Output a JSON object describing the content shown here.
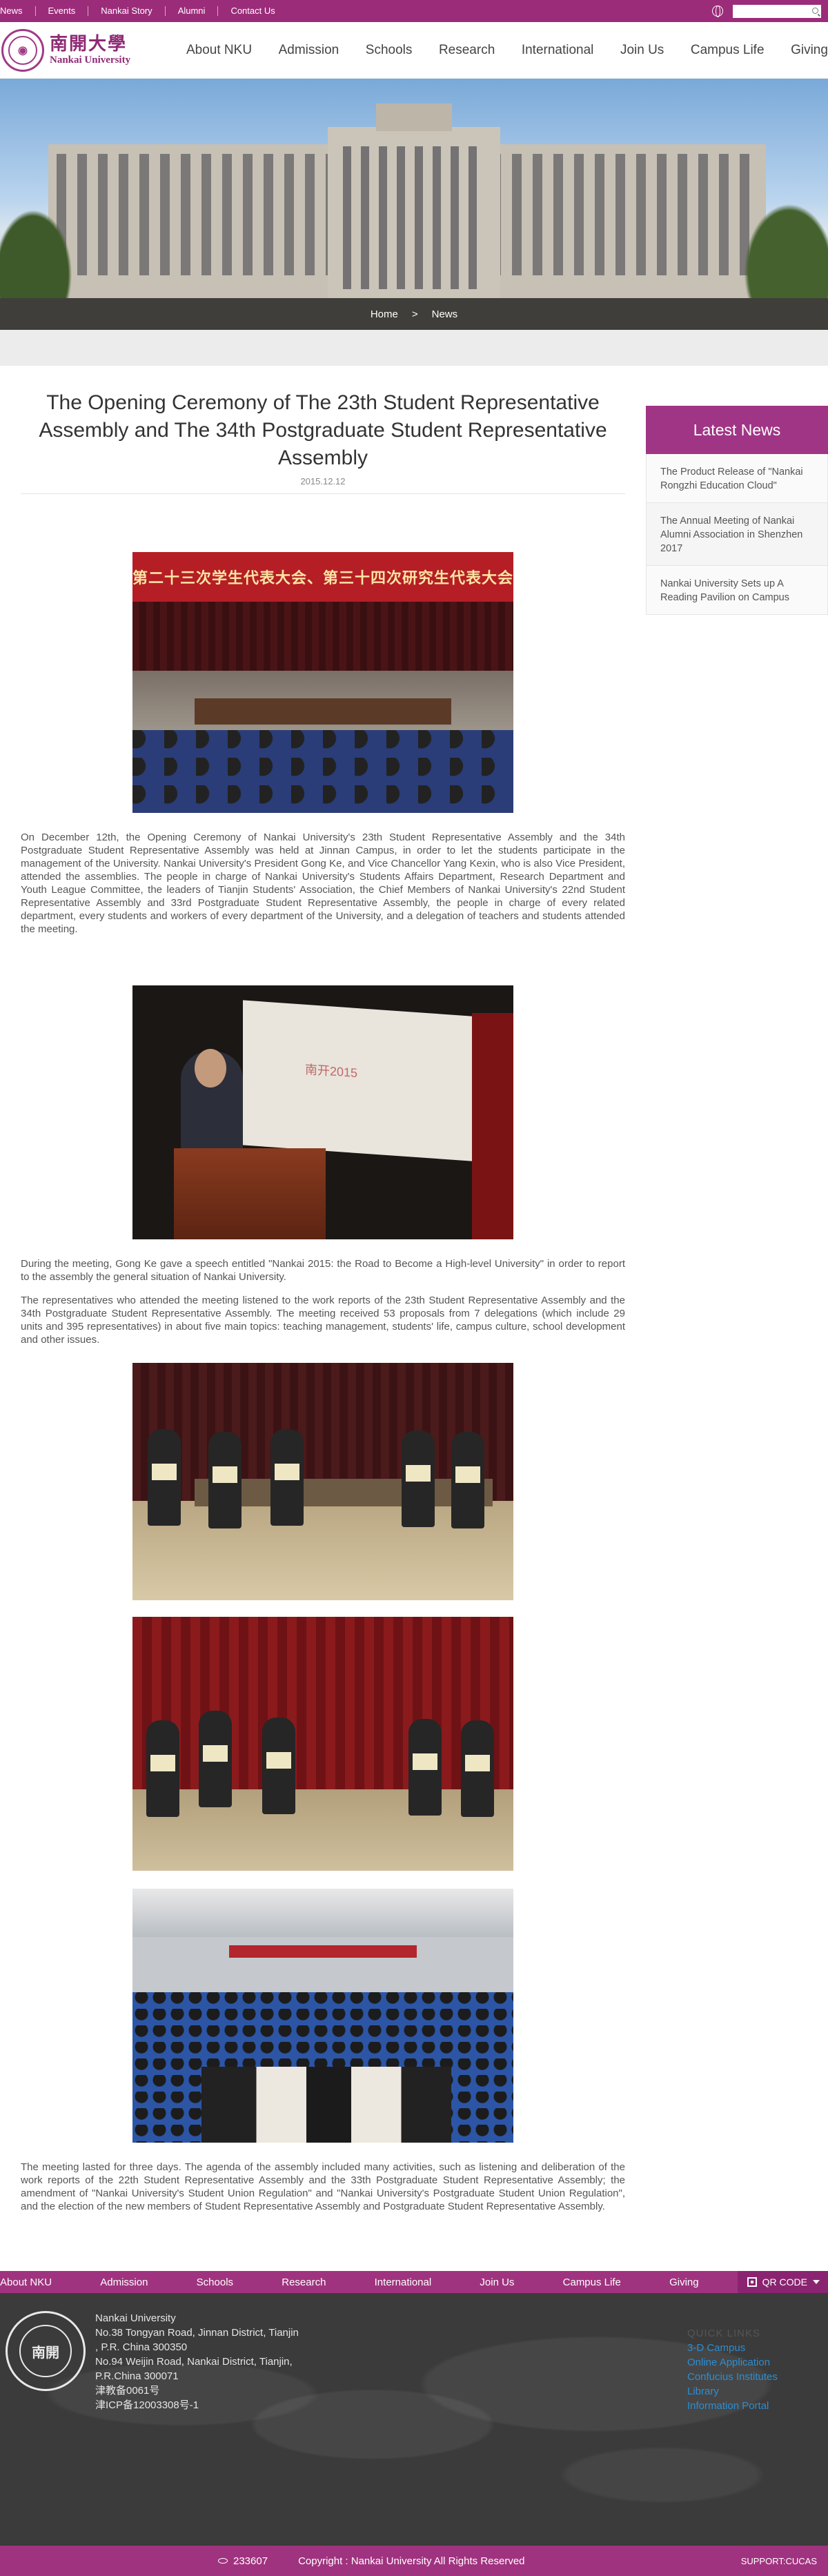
{
  "topbar": {
    "links": [
      "News",
      "Events",
      "Nankai Story",
      "Alumni",
      "Contact Us"
    ],
    "search_placeholder": ""
  },
  "header": {
    "logo_cn": "南開大學",
    "logo_en": "Nankai University",
    "nav": [
      "About NKU",
      "Admission",
      "Schools",
      "Research",
      "International",
      "Join Us",
      "Campus Life",
      "Giving"
    ]
  },
  "breadcrumb": {
    "home": "Home",
    "separator": ">",
    "current": "News"
  },
  "article": {
    "title": "The Opening Ceremony of The 23th Student Representative Assembly and The 34th Postgraduate Student Representative Assembly",
    "date": "2015.12.12",
    "photo1_banner": "第二十三次学生代表大会、第三十四次研究生代表大会",
    "photo2_screen": "南开2015",
    "paragraphs": [
      "On December 12th, the Opening Ceremony of Nankai University's 23th Student Representative Assembly and the 34th Postgraduate Student Representative Assembly was held at Jinnan Campus, in order to let the students participate in the management of the University. Nankai University's President Gong Ke, and Vice Chancellor Yang Kexin, who is also Vice President, attended the assemblies. The people in charge of Nankai University's Students Affairs Department, Research Department and Youth League Committee, the leaders of Tianjin Students' Association, the Chief Members of Nankai University's 22nd Student Representative Assembly and 33rd Postgraduate Student Representative Assembly, the people in charge of every related department, every students and workers of every department of the University, and a delegation of teachers and students attended the meeting.",
      "During the meeting, Gong Ke gave a speech entitled \"Nankai 2015: the Road to Become a High-level University\" in order to report to the assembly the general situation of Nankai University.",
      "The representatives who attended the meeting listened to the work reports of the 23th Student Representative Assembly and the 34th Postgraduate Student Representative Assembly. The meeting received 53 proposals from 7 delegations (which include 29 units and 395 representatives) in about five main topics: teaching management, students' life, campus culture, school development and other issues.",
      "The meeting lasted for three days. The agenda of the assembly included many activities, such as listening and deliberation of the work reports of the 22th Student Representative Assembly and the 33th Postgraduate Student Representative Assembly; the amendment of \"Nankai University's Student Union Regulation\" and \"Nankai University's Postgraduate Student Union Regulation\", and the election of the new members of Student Representative Assembly and Postgraduate Student Representative Assembly."
    ]
  },
  "sidebar": {
    "heading": "Latest News",
    "items": [
      "The Product Release of \"Nankai Rongzhi Education Cloud\"",
      "The Annual Meeting of Nankai Alumni Association in Shenzhen 2017",
      "Nankai University Sets up A Reading Pavilion on Campus"
    ]
  },
  "footer": {
    "nav": [
      "About NKU",
      "Admission",
      "Schools",
      "Research",
      "International",
      "Join Us",
      "Campus Life",
      "Giving"
    ],
    "qr_label": "QR CODE",
    "seal_text": "南開",
    "address": [
      "Nankai University",
      "No.38 Tongyan Road, Jinnan District, Tianjin",
      ", P.R. China 300350",
      "No.94 Weijin Road,  Nankai District, Tianjin,",
      "P.R.China  300071",
      "津教备0061号",
      "津ICP备12003308号-1"
    ],
    "quick_links_heading": "QUICK LINKS",
    "quick_links": [
      "3-D Campus",
      "Online Application",
      "Confucius Institutes",
      "Library",
      "Information Portal"
    ],
    "visits": "233607",
    "copyright": "Copyright : Nankai University All Rights Reserved",
    "support": "SUPPORT:CUCAS"
  },
  "colors": {
    "brand_purple": "#9b2c79",
    "link_blue": "#2b8ed2",
    "footer_dark": "#3b3b3b"
  }
}
